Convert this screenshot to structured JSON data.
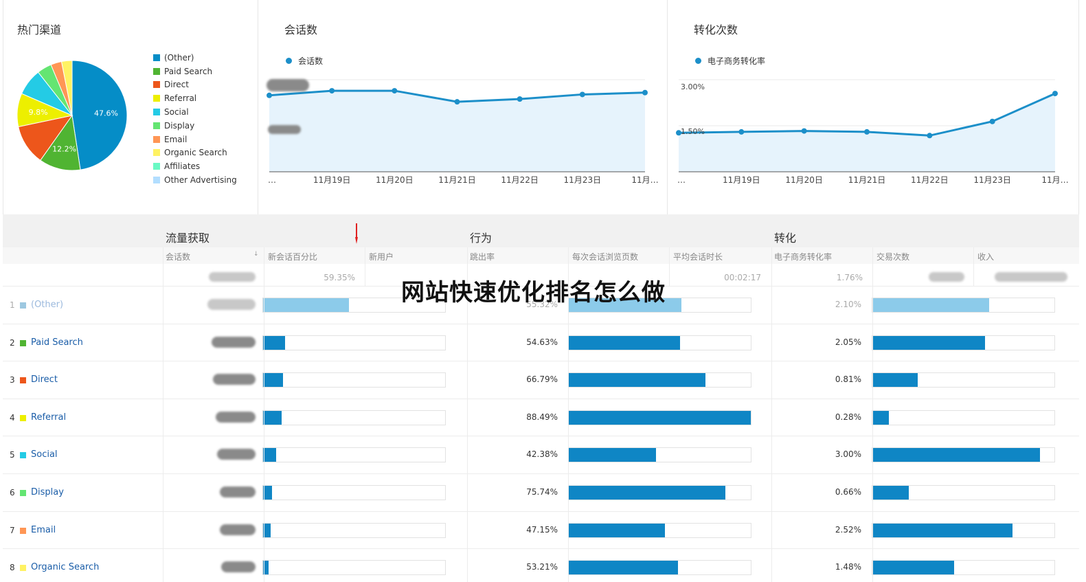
{
  "panels": {
    "channels": {
      "title": "热门渠道"
    },
    "sessions": {
      "title": "会话数",
      "series": "会话数"
    },
    "conversions": {
      "title": "转化次数",
      "series": "电子商务转化率"
    }
  },
  "chart_data": [
    {
      "type": "pie",
      "title": "热门渠道",
      "categories": [
        "(Other)",
        "Paid Search",
        "Direct",
        "Referral",
        "Social",
        "Display",
        "Email",
        "Organic Search",
        "Affiliates",
        "Other Advertising"
      ],
      "values": [
        47.6,
        12.2,
        11.9,
        9.8,
        7.9,
        4.3,
        3.2,
        3.1,
        0.0,
        0.0
      ],
      "slice_labels": [
        "47.6%",
        "12.2%",
        "",
        "9.8%",
        "",
        "",
        "",
        "",
        "",
        ""
      ],
      "colors": [
        "#058dc7",
        "#50b432",
        "#ed561b",
        "#edef00",
        "#24cbe5",
        "#64e572",
        "#ff9655",
        "#fff263",
        "#6af9c4",
        "#b2deff"
      ]
    },
    {
      "type": "area",
      "title": "会话数",
      "x": [
        "…",
        "11月19日",
        "11月20日",
        "11月21日",
        "11月22日",
        "11月23日",
        "11月…"
      ],
      "series": [
        {
          "name": "会话数",
          "values": [
            0.83,
            0.88,
            0.88,
            0.76,
            0.79,
            0.84,
            0.86
          ]
        }
      ],
      "ylim": [
        0,
        1
      ]
    },
    {
      "type": "area",
      "title": "转化次数",
      "x": [
        "…",
        "11月19日",
        "11月20日",
        "11月21日",
        "11月22日",
        "11月23日",
        "11月…"
      ],
      "series": [
        {
          "name": "电子商务转化率",
          "values": [
            1.27,
            1.3,
            1.33,
            1.3,
            1.18,
            1.64,
            2.55
          ]
        }
      ],
      "y_ticks": [
        "3.00%",
        "1.50%"
      ],
      "ylim": [
        0,
        3.0
      ]
    }
  ],
  "table": {
    "groups": [
      "流量获取",
      "行为",
      "转化"
    ],
    "columns": [
      "会话数",
      "新会话百分比",
      "新用户",
      "跳出率",
      "每次会话浏览页数",
      "平均会话时长",
      "电子商务转化率",
      "交易次数",
      "收入"
    ],
    "totals": {
      "new_session_pct": "59.35%",
      "avg_duration": "00:02:17",
      "conv_rate": "1.76%"
    },
    "rows": [
      {
        "index": "1",
        "name": "(Other)",
        "color": "#9dc8e0",
        "new_pct": 0.47,
        "bounce": "55.32%",
        "bounce_frac": 0.62,
        "conv": "2.10%",
        "conv_frac": 0.64
      },
      {
        "index": "2",
        "name": "Paid Search",
        "color": "#50b432",
        "new_pct": 0.12,
        "bounce": "54.63%",
        "bounce_frac": 0.61,
        "conv": "2.05%",
        "conv_frac": 0.62
      },
      {
        "index": "3",
        "name": "Direct",
        "color": "#ed561b",
        "new_pct": 0.11,
        "bounce": "66.79%",
        "bounce_frac": 0.75,
        "conv": "0.81%",
        "conv_frac": 0.25
      },
      {
        "index": "4",
        "name": "Referral",
        "color": "#edef00",
        "new_pct": 0.1,
        "bounce": "88.49%",
        "bounce_frac": 1.0,
        "conv": "0.28%",
        "conv_frac": 0.09
      },
      {
        "index": "5",
        "name": "Social",
        "color": "#24cbe5",
        "new_pct": 0.07,
        "bounce": "42.38%",
        "bounce_frac": 0.48,
        "conv": "3.00%",
        "conv_frac": 0.92
      },
      {
        "index": "6",
        "name": "Display",
        "color": "#64e572",
        "new_pct": 0.05,
        "bounce": "75.74%",
        "bounce_frac": 0.86,
        "conv": "0.66%",
        "conv_frac": 0.2
      },
      {
        "index": "7",
        "name": "Email",
        "color": "#ff9655",
        "new_pct": 0.04,
        "bounce": "47.15%",
        "bounce_frac": 0.53,
        "conv": "2.52%",
        "conv_frac": 0.77
      },
      {
        "index": "8",
        "name": "Organic Search",
        "color": "#fff263",
        "new_pct": 0.03,
        "bounce": "53.21%",
        "bounce_frac": 0.6,
        "conv": "1.48%",
        "conv_frac": 0.45
      }
    ]
  },
  "watermark": "网站快速优化排名怎么做",
  "colors": {
    "accent": "#0f86c5",
    "line": "#1c8fc9",
    "area": "#e6f3fc"
  }
}
